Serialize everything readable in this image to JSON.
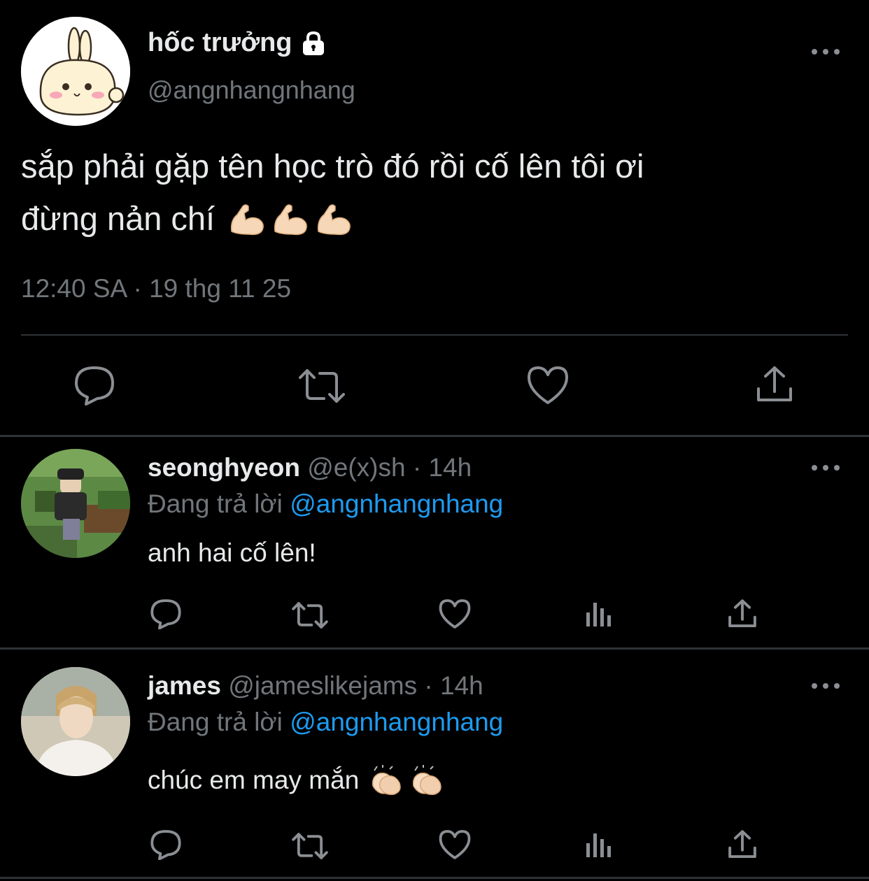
{
  "main_tweet": {
    "display_name": "hốc trưởng",
    "protected_icon": "lock-icon",
    "handle": "@angnhangnhang",
    "text_line1": "sắp phải gặp tên học trò đó rồi cố lên tôi ơi",
    "text_line2": "đừng nản chí",
    "emoji": "flexed-biceps-emoji x3",
    "timestamp": "12:40 SA · 19 thg 11 25",
    "actions": [
      "reply-icon",
      "retweet-icon",
      "like-icon",
      "share-icon"
    ]
  },
  "replies": [
    {
      "display_name": "seonghyeon",
      "handle_time": "@e(x)sh · 14h",
      "replying_prefix": "Đang trả lời",
      "replying_to": "@angnhangnhang",
      "text": "anh hai cố lên!",
      "actions": [
        "reply-icon",
        "retweet-icon",
        "like-icon",
        "analytics-icon",
        "share-icon"
      ]
    },
    {
      "display_name": "james",
      "handle_time": "@jameslikejams · 14h",
      "replying_prefix": "Đang trả lời",
      "replying_to": "@angnhangnhang",
      "text": "chúc em may mắn",
      "emoji": "clapping-hands-emoji x2",
      "actions": [
        "reply-icon",
        "retweet-icon",
        "like-icon",
        "analytics-icon",
        "share-icon"
      ]
    }
  ],
  "colors": {
    "background": "#000000",
    "text": "#e7e9ea",
    "secondary": "#71767b",
    "mention": "#1d9bf0",
    "divider": "#2f3336"
  }
}
